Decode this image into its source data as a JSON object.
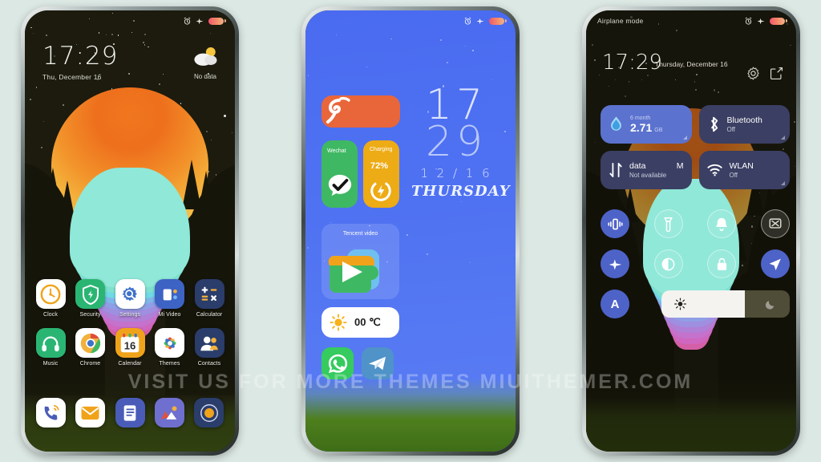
{
  "page": {
    "background_color": "#dce8e4",
    "watermark": "VISIT  US  FOR  MORE  THEMES  MIUITHEMER.COM"
  },
  "status_bar": {
    "icons": [
      "alarm-icon",
      "airplane-icon",
      "battery-icon"
    ],
    "battery_color": "#f2566e"
  },
  "phone1": {
    "name": "home-screen",
    "status_left": "",
    "clock": {
      "time": "17:29",
      "date": "Thu, December 16"
    },
    "weather": {
      "icon": "partly-cloudy-icon",
      "text": "No data"
    },
    "apps_row1": [
      {
        "label": "Clock",
        "icon": "clock-icon",
        "bg": "#ffffff"
      },
      {
        "label": "Security",
        "icon": "shield-icon",
        "bg": "#2bb573"
      },
      {
        "label": "Settings",
        "icon": "gear-icon",
        "bg": "#ffffff"
      },
      {
        "label": "Mi Video",
        "icon": "video-icon",
        "bg": "#3d63c4"
      },
      {
        "label": "Calculator",
        "icon": "calculator-icon",
        "bg": "#2a3d6b"
      }
    ],
    "apps_row2": [
      {
        "label": "Music",
        "icon": "headphones-icon",
        "bg": "#2bb573"
      },
      {
        "label": "Chrome",
        "icon": "chrome-icon",
        "bg": "#ffffff"
      },
      {
        "label": "Calendar",
        "icon": "calendar-icon",
        "bg": "#f0a31a",
        "day": "16"
      },
      {
        "label": "Themes",
        "icon": "flower-icon",
        "bg": "#ffffff"
      },
      {
        "label": "Contacts",
        "icon": "contacts-icon",
        "bg": "#2a3d6b"
      }
    ],
    "dock": [
      {
        "label": "Phone",
        "icon": "phone-icon",
        "bg": "#ffffff"
      },
      {
        "label": "Messaging",
        "icon": "envelope-icon",
        "bg": "#ffffff"
      },
      {
        "label": "Notes",
        "icon": "notes-icon",
        "bg": "#4a5cb8"
      },
      {
        "label": "Gallery",
        "icon": "gallery-icon",
        "bg": "#6f6fcf"
      },
      {
        "label": "Browser",
        "icon": "browser-icon",
        "bg": "#2a3d6b"
      }
    ]
  },
  "phone2": {
    "name": "widget-screen",
    "background_color": "#4f72f2",
    "clock": {
      "hours": "17",
      "minutes": "29",
      "date": "1 2 / 1 6",
      "weekday": "THURSDAY"
    },
    "widgets": [
      {
        "name": "orange-banner-widget",
        "label": "",
        "icon": "swirl-icon",
        "bg": "#e8663a"
      },
      {
        "name": "wechat-widget",
        "label": "Wechat",
        "icon": "wechat-icon",
        "bg": "#3fb863"
      },
      {
        "name": "battery-widget",
        "label": "Charging",
        "value": "72%",
        "icon": "charging-icon",
        "bg": "#edab16"
      },
      {
        "name": "tencent-video-widget",
        "label": "Tencent video",
        "icon": "tencent-video-icon"
      },
      {
        "name": "weather-widget",
        "value": "00 ℃",
        "icon": "sun-icon",
        "bg": "#ffffff"
      }
    ],
    "apps": [
      {
        "label": "WhatsApp",
        "icon": "whatsapp-icon",
        "bg": "#35cb5f"
      },
      {
        "label": "Telegram",
        "icon": "telegram-icon",
        "bg": "#4f93c8"
      }
    ]
  },
  "phone3": {
    "name": "control-center",
    "airplane_label": "Airplane mode",
    "time": "17:29",
    "date": "Thursday, December 16",
    "actions": [
      {
        "name": "settings-gear-icon",
        "label": "Settings"
      },
      {
        "name": "edit-icon",
        "label": "Edit"
      }
    ],
    "cards": [
      {
        "name": "data-usage-card",
        "small": "6 month",
        "value": "2.71",
        "unit": "GB",
        "icon": "data-drop-icon",
        "state": "active"
      },
      {
        "name": "bluetooth-card",
        "title": "Bluetooth",
        "sub": "Off",
        "icon": "bluetooth-icon",
        "state": "idle"
      },
      {
        "name": "mobile-data-card",
        "title": "data",
        "title2": "M",
        "sub": "Not available",
        "icon": "data-arrows-icon",
        "state": "idle"
      },
      {
        "name": "wlan-card",
        "title": "WLAN",
        "sub": "Off",
        "icon": "wifi-icon",
        "state": "idle"
      }
    ],
    "toggles": [
      {
        "name": "vibrate-toggle",
        "icon": "vibrate-icon",
        "state": "on"
      },
      {
        "name": "flashlight-toggle",
        "icon": "flashlight-icon",
        "state": "ghost"
      },
      {
        "name": "ringer-toggle",
        "icon": "bell-icon",
        "state": "ghost"
      },
      {
        "name": "screen-cast-toggle",
        "icon": "cast-icon",
        "state": "off"
      },
      {
        "name": "airplane-toggle",
        "icon": "airplane-icon",
        "state": "on"
      },
      {
        "name": "dark-mode-toggle",
        "icon": "contrast-icon",
        "state": "ghost"
      },
      {
        "name": "lock-toggle",
        "icon": "lock-icon",
        "state": "ghost"
      },
      {
        "name": "location-toggle",
        "icon": "location-icon",
        "state": "on"
      },
      {
        "name": "auto-brightness-toggle",
        "icon": "letter-a-icon",
        "state": "on"
      }
    ],
    "brightness": {
      "name": "brightness-slider",
      "percent": 65,
      "left_icon": "sun-icon",
      "right_icon": "moon-icon"
    }
  }
}
